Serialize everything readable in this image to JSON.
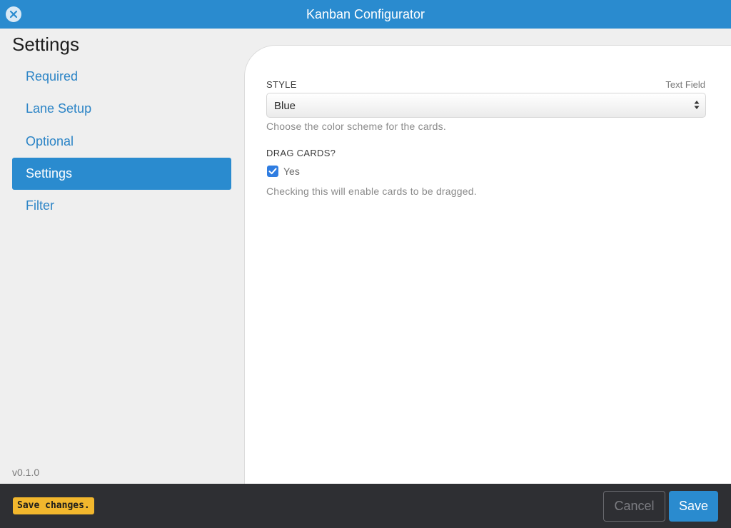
{
  "window": {
    "title": "Kanban Configurator",
    "close_icon": "close-icon"
  },
  "sidebar": {
    "heading": "Settings",
    "items": [
      {
        "label": "Required",
        "active": false
      },
      {
        "label": "Lane Setup",
        "active": false
      },
      {
        "label": "Optional",
        "active": false
      },
      {
        "label": "Settings",
        "active": true
      },
      {
        "label": "Filter",
        "active": false
      }
    ],
    "version": "v0.1.0"
  },
  "main": {
    "style_field": {
      "label": "STYLE",
      "type": "Text Field",
      "value": "Blue",
      "help": "Choose the color scheme for the cards."
    },
    "drag_field": {
      "label": "DRAG CARDS?",
      "checkbox_label": "Yes",
      "checked": true,
      "help": "Checking this will enable cards to be dragged."
    }
  },
  "footer": {
    "badge": "Save changes.",
    "cancel_label": "Cancel",
    "save_label": "Save"
  },
  "colors": {
    "accent": "#2a8bcf",
    "footer_bg": "#2e2f33",
    "badge": "#f2b72d",
    "checkbox": "#2f7de1"
  }
}
